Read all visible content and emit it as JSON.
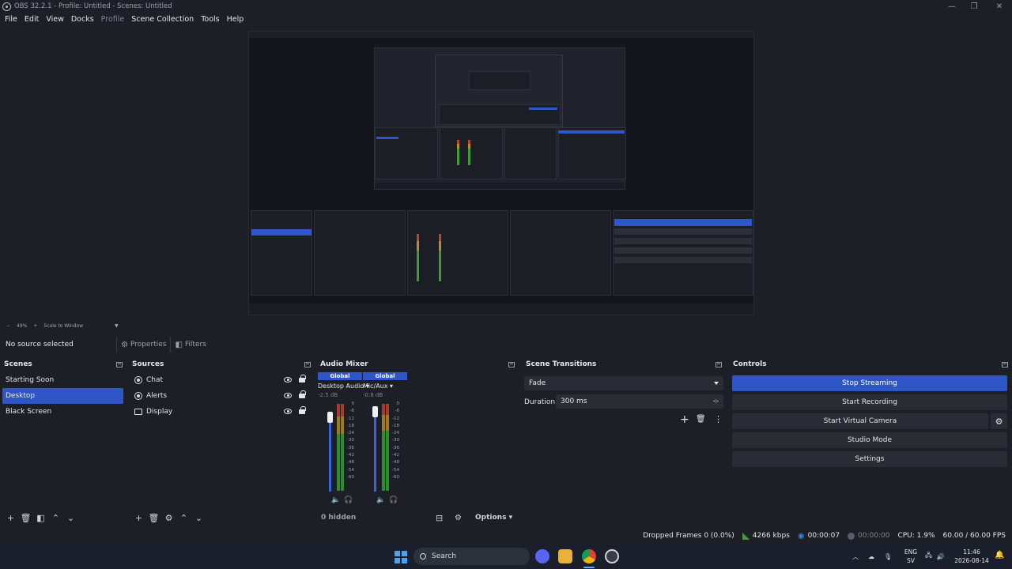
{
  "window": {
    "title": "OBS 32.2.1 - Profile: Untitled - Scenes: Untitled",
    "controls": [
      "—",
      "❐",
      "✕"
    ]
  },
  "menu": [
    "File",
    "Edit",
    "View",
    "Docks",
    "Profile",
    "Scene Collection",
    "Tools",
    "Help"
  ],
  "preview": {
    "zoom": "49%",
    "scale_mode": "Scale to Window"
  },
  "source_toolbar": {
    "status": "No source selected",
    "properties_label": "Properties",
    "filters_label": "Filters"
  },
  "scenes": {
    "title": "Scenes",
    "items": [
      "Starting Soon",
      "Desktop",
      "Black Screen"
    ],
    "selected_index": 1
  },
  "sources": {
    "title": "Sources",
    "items": [
      {
        "name": "Chat",
        "icon": "browser-source-icon"
      },
      {
        "name": "Alerts",
        "icon": "browser-source-icon"
      },
      {
        "name": "Display",
        "icon": "monitor-icon"
      }
    ]
  },
  "audio_mixer": {
    "title": "Audio Mixer",
    "channels": [
      {
        "global": "Global",
        "name": "Desktop Audio",
        "db": "-2.5 dB"
      },
      {
        "global": "Global",
        "name": "Mic/Aux",
        "db": "-0.8 dB"
      }
    ],
    "scale": [
      "0",
      "-6",
      "-12",
      "-18",
      "-24",
      "-30",
      "-36",
      "-42",
      "-48",
      "-54",
      "-60"
    ],
    "hidden_label": "0 hidden",
    "options_label": "Options"
  },
  "scene_transitions": {
    "title": "Scene Transitions",
    "transition": "Fade",
    "duration_label": "Duration",
    "duration_value": "300 ms"
  },
  "controls": {
    "title": "Controls",
    "buttons": [
      "Stop Streaming",
      "Start Recording",
      "Start Virtual Camera",
      "Studio Mode",
      "Settings"
    ]
  },
  "statusbar": {
    "dropped_frames": "Dropped Frames 0 (0.0%)",
    "bitrate": "4266 kbps",
    "stream_time": "00:00:07",
    "rec_time": "00:00:00",
    "cpu": "CPU: 1.9%",
    "fps": "60.00 / 60.00 FPS"
  },
  "taskbar": {
    "search_label": "Search",
    "lang_top": "ENG",
    "lang_bottom": "SV",
    "time": "11:46",
    "date": "2026-08-14"
  },
  "colors": {
    "accent": "#2f56c9",
    "background": "#1d1f26"
  }
}
